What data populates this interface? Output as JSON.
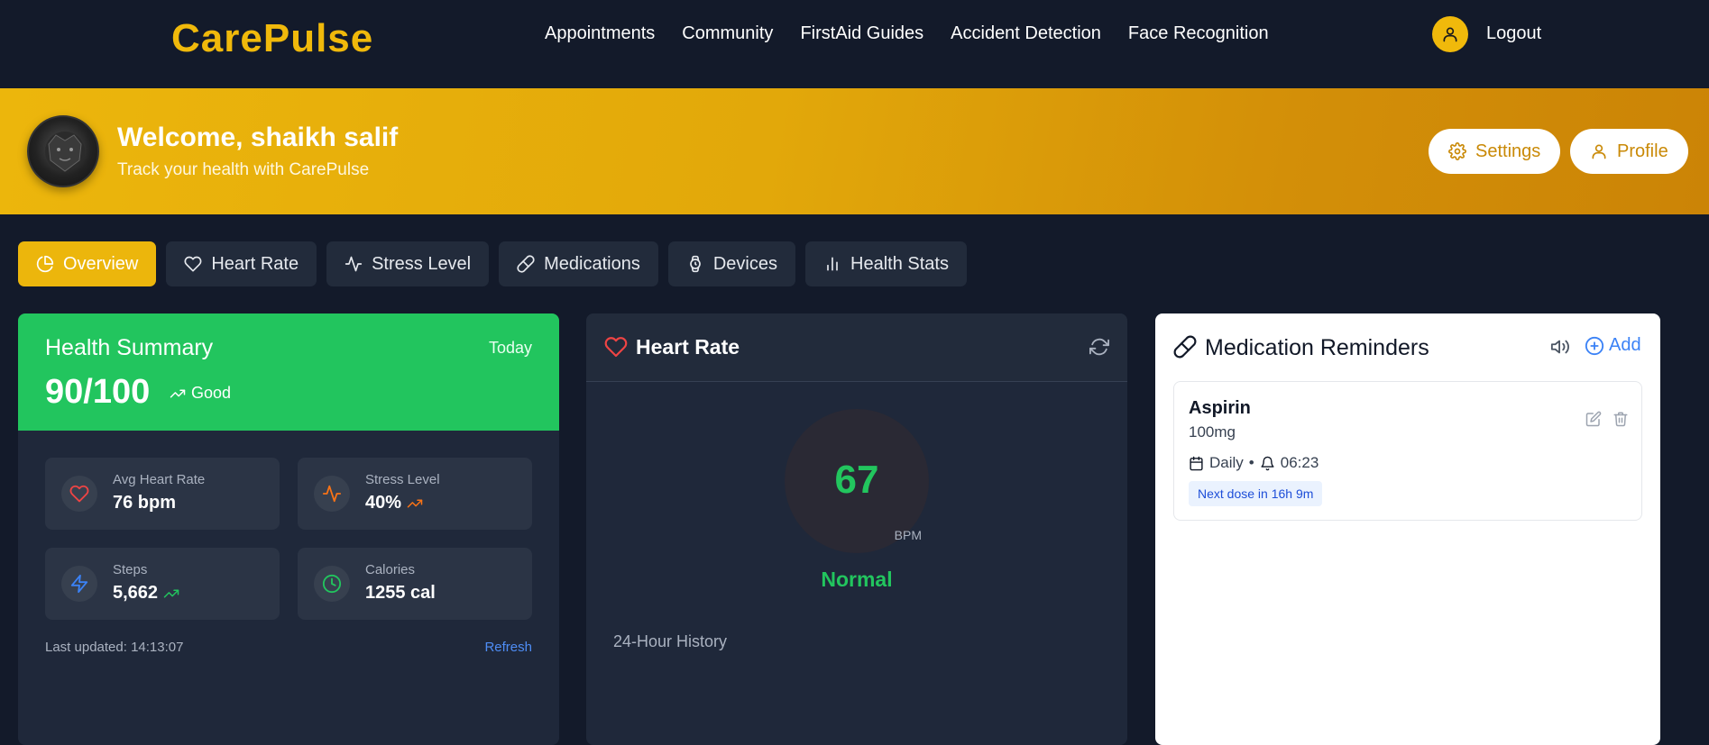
{
  "nav": {
    "brand": "CarePulse",
    "links": [
      "Appointments",
      "Community",
      "FirstAid Guides",
      "Accident Detection",
      "Face Recognition"
    ],
    "logout": "Logout",
    "user_icon": "user-icon"
  },
  "banner": {
    "title": "Welcome, shaikh salif",
    "subtitle": "Track your health with CarePulse",
    "settings": "Settings",
    "profile": "Profile"
  },
  "tabs": [
    {
      "label": "Overview",
      "icon": "pie-chart-icon",
      "active": true
    },
    {
      "label": "Heart Rate",
      "icon": "heart-icon",
      "active": false
    },
    {
      "label": "Stress Level",
      "icon": "activity-icon",
      "active": false
    },
    {
      "label": "Medications",
      "icon": "pill-icon",
      "active": false
    },
    {
      "label": "Devices",
      "icon": "watch-icon",
      "active": false
    },
    {
      "label": "Health Stats",
      "icon": "bar-chart-icon",
      "active": false
    }
  ],
  "summary": {
    "title": "Health Summary",
    "period": "Today",
    "score": "90/100",
    "status": "Good",
    "stats": [
      {
        "label": "Avg Heart Rate",
        "value": "76 bpm",
        "icon": "heart-icon",
        "color": "#ef4444"
      },
      {
        "label": "Stress Level",
        "value": "40%",
        "icon": "activity-icon",
        "color": "#f97316"
      },
      {
        "label": "Steps",
        "value": "5,662",
        "icon": "zap-icon",
        "color": "#3b82f6"
      },
      {
        "label": "Calories",
        "value": "1255 cal",
        "icon": "clock-icon",
        "color": "#22c55e"
      }
    ],
    "last_updated": "Last updated: 14:13:07",
    "refresh": "Refresh"
  },
  "heart": {
    "title": "Heart Rate",
    "value": "67",
    "unit": "BPM",
    "status": "Normal",
    "history_title": "24-Hour History"
  },
  "meds": {
    "title": "Medication Reminders",
    "add": "Add",
    "items": [
      {
        "name": "Aspirin",
        "dose": "100mg",
        "frequency": "Daily",
        "time": "06:23",
        "next": "Next dose in 16h 9m"
      }
    ]
  },
  "colors": {
    "accent": "#ecb60c",
    "background": "#131a2a",
    "card": "#1f283a",
    "success": "#22c55e",
    "link": "#3b82f6"
  }
}
